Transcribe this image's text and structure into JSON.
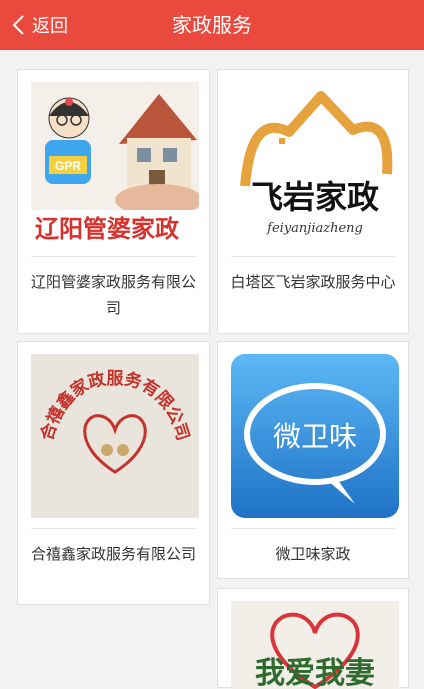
{
  "header": {
    "back_label": "返回",
    "title": "家政服务"
  },
  "cards": [
    {
      "name": "辽阳管婆家政服务有限公司",
      "logo_text": "辽阳管婆家政",
      "badge": "GPR"
    },
    {
      "name": "白塔区飞岩家政服务中心",
      "logo_text": "飞岩家政",
      "logo_sub": "feiyanjiazheng"
    },
    {
      "name": "合禧鑫家政服务有限公司",
      "logo_text": "合禧鑫家政服务有限公司"
    },
    {
      "name": "微卫味家政",
      "logo_text": "微卫味"
    },
    {
      "name": "",
      "logo_text": "我爱我妻"
    }
  ],
  "colors": {
    "header": "#ea4a3e",
    "background": "#f2f2f2",
    "card": "#ffffff"
  }
}
